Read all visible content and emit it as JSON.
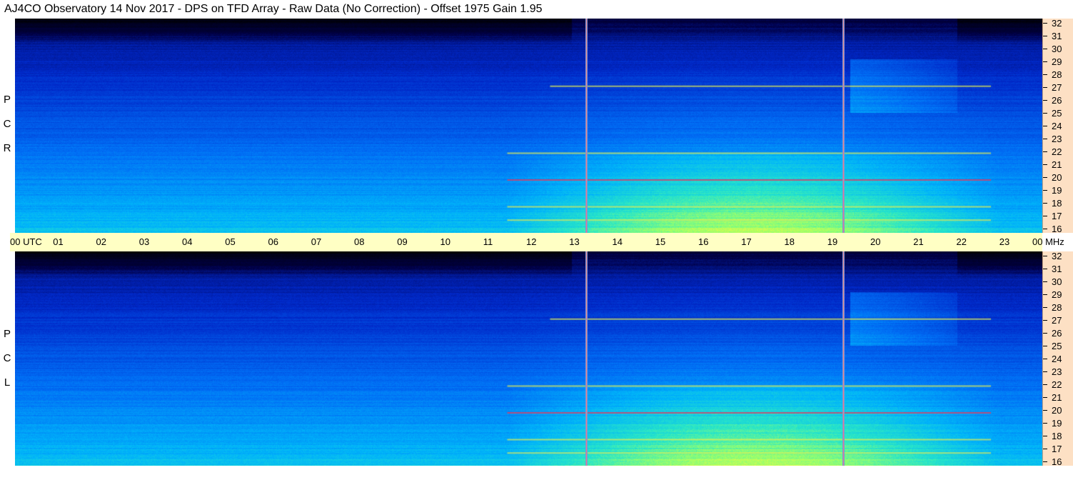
{
  "title": "AJ4CO Observatory  14 Nov 2017  -  DPS on TFD Array  -  Raw Data (No Correction)  -  Offset 1975  Gain 1.95",
  "panels": [
    {
      "name": "RCP",
      "letters": [
        "R",
        "C",
        "P"
      ]
    },
    {
      "name": "LCP",
      "letters": [
        "L",
        "C",
        "P"
      ]
    }
  ],
  "time_axis": {
    "labels": [
      "00 UTC",
      "01",
      "02",
      "03",
      "04",
      "05",
      "06",
      "07",
      "08",
      "09",
      "10",
      "11",
      "12",
      "13",
      "14",
      "15",
      "16",
      "17",
      "18",
      "19",
      "20",
      "21",
      "22",
      "23",
      "00 MHz"
    ]
  },
  "colors": {
    "freq_axis_bg": "#fde0c4",
    "time_axis_bg": "#ffffc4"
  },
  "chart_data": {
    "type": "heatmap",
    "x_label": "UTC",
    "x_range_hours": [
      0,
      24
    ],
    "y_label": "MHz",
    "y_range_mhz": [
      16,
      32
    ],
    "y_ticks": [
      32,
      31,
      30,
      29,
      28,
      27,
      26,
      25,
      24,
      23,
      22,
      21,
      20,
      19,
      18,
      17,
      16
    ],
    "colormap": "black-blue-cyan-green-yellow-red",
    "markers_utc": [
      13.33,
      19.33
    ],
    "strong_bands_mhz": [
      27.0,
      22.0,
      20.0,
      18.0,
      17.0
    ]
  }
}
